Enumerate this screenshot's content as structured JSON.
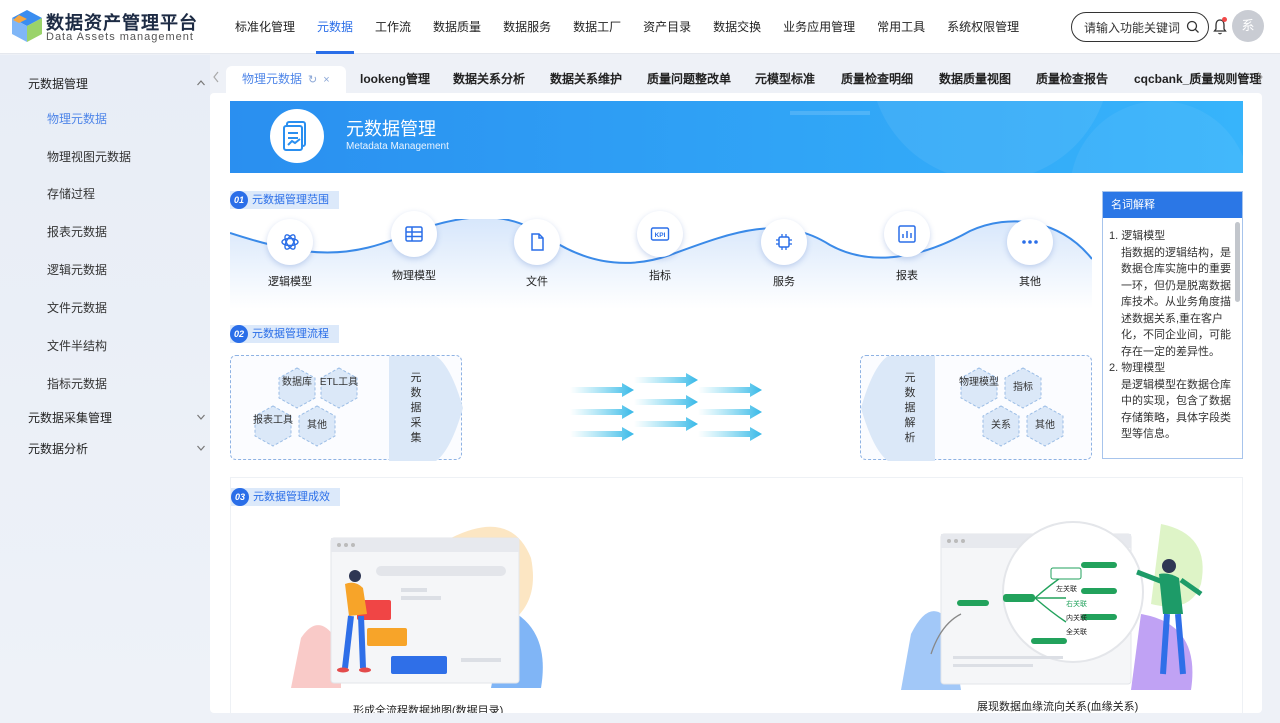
{
  "brand": {
    "title": "数据资产管理平台",
    "subtitle": "Data Assets management"
  },
  "nav": [
    "标准化管理",
    "元数据",
    "工作流",
    "数据质量",
    "数据服务",
    "数据工厂",
    "资产目录",
    "数据交换",
    "业务应用管理",
    "常用工具",
    "系统权限管理"
  ],
  "nav_active": "元数据",
  "search": {
    "placeholder": "请输入功能关键词"
  },
  "avatar": "系",
  "sidebar": {
    "groups": [
      {
        "label": "元数据管理",
        "expanded": true,
        "items": [
          "物理元数据",
          "物理视图元数据",
          "存储过程",
          "报表元数据",
          "逻辑元数据",
          "文件元数据",
          "文件半结构",
          "指标元数据"
        ],
        "active": "物理元数据"
      },
      {
        "label": "元数据采集管理",
        "expanded": false
      },
      {
        "label": "元数据分析",
        "expanded": false
      }
    ]
  },
  "tabs": [
    "物理元数据",
    "lookeng管理",
    "数据关系分析",
    "数据关系维护",
    "质量问题整改单",
    "元模型标准",
    "质量检查明细",
    "数据质量视图",
    "质量检查报告",
    "cqcbank_质量规则管理"
  ],
  "banner": {
    "title": "元数据管理",
    "subtitle": "Metadata Management"
  },
  "sections": {
    "scope": {
      "num": "01",
      "title": "元数据管理范围",
      "nodes": [
        "逻辑模型",
        "物理模型",
        "文件",
        "指标",
        "服务",
        "报表",
        "其他"
      ]
    },
    "flow": {
      "num": "02",
      "title": "元数据管理流程",
      "sources": [
        "数据库",
        "ETL工具",
        "报表工具",
        "其他"
      ],
      "collect": "元数据采集",
      "parse": "元数据解析",
      "targets": [
        "物理模型",
        "指标",
        "关系",
        "其他"
      ]
    },
    "result": {
      "num": "03",
      "title": "元数据管理成效",
      "left_caption": "形成全流程数据地图(数据目录)",
      "right_caption": "展现数据血缘流向关系(血缘关系)",
      "mindmap_labels": [
        "左关联",
        "右关联",
        "内关联",
        "全关联"
      ]
    }
  },
  "glossary": {
    "title": "名词解释",
    "items": [
      {
        "term": "1. 逻辑模型",
        "desc": "指数据的逻辑结构，是数据仓库实施中的重要一环，但仍是脱离数据库技术。从业务角度描述数据关系,重在客户化，不同企业间，可能存在一定的差异性。"
      },
      {
        "term": "2. 物理模型",
        "desc": "是逻辑模型在数据仓库中的实现，包含了数据存储策略，具体字段类型等信息。"
      }
    ]
  },
  "colors": {
    "accent": "#2a6ee8",
    "banner": "#2a8ff0",
    "glossary_head": "#2b77e6"
  }
}
